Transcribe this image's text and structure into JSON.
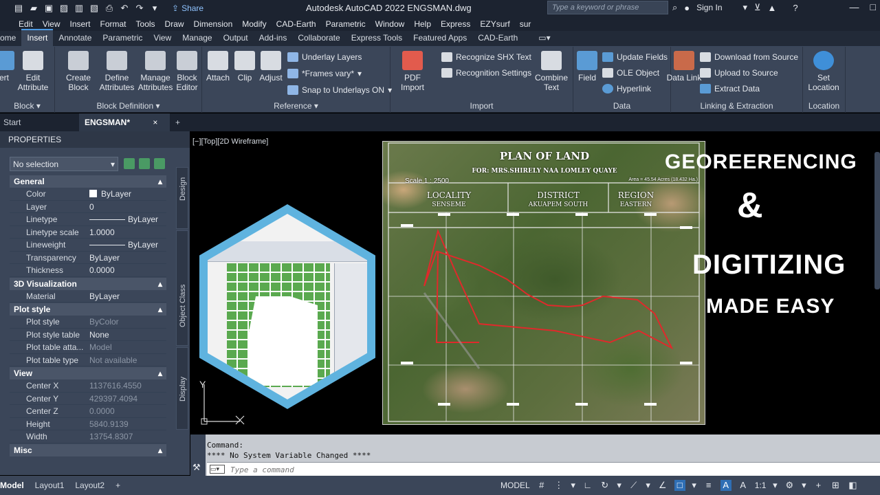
{
  "titlebar": {
    "share_label": "Share",
    "app_title": "Autodesk AutoCAD 2022   ENGSMAN.dwg",
    "search_placeholder": "Type a keyword or phrase",
    "sign_in": "Sign In"
  },
  "menu": [
    "Edit",
    "View",
    "Insert",
    "Format",
    "Tools",
    "Draw",
    "Dimension",
    "Modify",
    "CAD-Earth",
    "Parametric",
    "Window",
    "Help",
    "Express",
    "EZYsurf",
    "sur"
  ],
  "ribbon_tabs": [
    "ome",
    "Insert",
    "Annotate",
    "Parametric",
    "View",
    "Manage",
    "Output",
    "Add-ins",
    "Collaborate",
    "Express Tools",
    "Featured Apps",
    "CAD-Earth"
  ],
  "ribbon": {
    "block": {
      "insert_label": "ert",
      "edit_attr": "Edit Attribute",
      "title": "Block"
    },
    "block_def": {
      "create": "Create Block",
      "define": "Define Attributes",
      "manage": "Manage Attributes",
      "editor": "Block Editor",
      "title": "Block Definition"
    },
    "reference": {
      "attach": "Attach",
      "clip": "Clip",
      "adjust": "Adjust",
      "underlay": "Underlay Layers",
      "frames": "*Frames vary*",
      "snap": "Snap to Underlays ON",
      "title": "Reference"
    },
    "import": {
      "pdf": "PDF Import",
      "shx": "Recognize SHX Text",
      "settings": "Recognition Settings",
      "combine": "Combine Text",
      "title": "Import"
    },
    "data": {
      "field": "Field",
      "update": "Update Fields",
      "ole": "OLE Object",
      "hyperlink": "Hyperlink",
      "title": "Data"
    },
    "linking": {
      "datalink": "Data Link",
      "download": "Download from Source",
      "upload": "Upload to Source",
      "extract": "Extract  Data",
      "title": "Linking & Extraction"
    },
    "location": {
      "set": "Set Location",
      "title": "Location"
    }
  },
  "doc_tabs": {
    "start": "Start",
    "active": "ENGSMAN*",
    "close": "×",
    "add": "+"
  },
  "properties": {
    "title": "PROPERTIES",
    "selection": "No selection",
    "sections": {
      "general": "General",
      "viz": "3D Visualization",
      "plot": "Plot style",
      "view": "View",
      "misc": "Misc"
    },
    "general_rows": [
      {
        "k": "Color",
        "v": "ByLayer"
      },
      {
        "k": "Layer",
        "v": "0"
      },
      {
        "k": "Linetype",
        "v": "ByLayer"
      },
      {
        "k": "Linetype scale",
        "v": "1.0000"
      },
      {
        "k": "Lineweight",
        "v": "ByLayer"
      },
      {
        "k": "Transparency",
        "v": "ByLayer"
      },
      {
        "k": "Thickness",
        "v": "0.0000"
      }
    ],
    "viz_rows": [
      {
        "k": "Material",
        "v": "ByLayer"
      }
    ],
    "plot_rows": [
      {
        "k": "Plot style",
        "v": "ByColor"
      },
      {
        "k": "Plot style table",
        "v": "None"
      },
      {
        "k": "Plot table atta...",
        "v": "Model"
      },
      {
        "k": "Plot table type",
        "v": "Not available"
      }
    ],
    "view_rows": [
      {
        "k": "Center X",
        "v": "1137616.4550"
      },
      {
        "k": "Center Y",
        "v": "429397.4094"
      },
      {
        "k": "Center Z",
        "v": "0.0000"
      },
      {
        "k": "Height",
        "v": "5840.9139"
      },
      {
        "k": "Width",
        "v": "13754.8307"
      }
    ],
    "side_tabs": {
      "design": "Design",
      "object": "Object Class",
      "display": "Display"
    }
  },
  "viewport": {
    "label": "[−][Top][2D Wireframe]",
    "map": {
      "title": "PLAN OF LAND",
      "for": "FOR: MRS.SHIRELY NAA LOMLEY QUAYE",
      "scale": "Scale 1 : 2500",
      "area": "Area = 45.54 Acres (18.432 Ha.)",
      "locality_h": "LOCALITY",
      "locality_v": "SENSEME",
      "district_h": "DISTRICT",
      "district_v": "AKUAPEM SOUTH",
      "region_h": "REGION",
      "region_v": "EASTERN"
    },
    "overlay": {
      "line1": "GEOREERENCING",
      "line2": "&",
      "line3": "DIGITIZING",
      "line4": "MADE EASY"
    },
    "ucs_y": "Y"
  },
  "command": {
    "history1": "Command:",
    "history2": "**** No System Variable Changed ****",
    "placeholder": "Type a command"
  },
  "status": {
    "model_tab": "Model",
    "layout1": "Layout1",
    "layout2": "Layout2",
    "add": "+",
    "mode": "MODEL",
    "scale": "1:1"
  },
  "colors": {
    "accent": "#4d9be6",
    "boundary": "#e0292b",
    "hex_border": "#5fb3df"
  }
}
